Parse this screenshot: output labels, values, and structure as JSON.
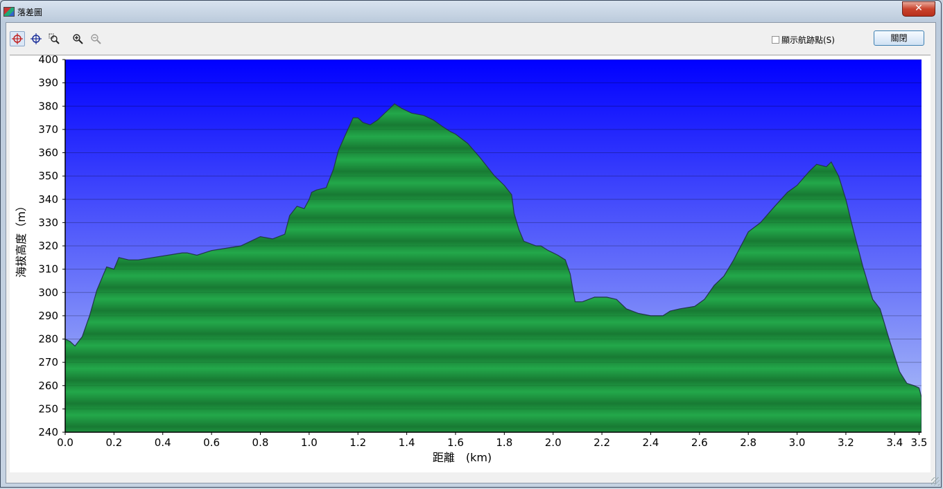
{
  "window": {
    "title": "落差圖",
    "close_glyph": "✕"
  },
  "toolbar": {
    "tools": [
      {
        "name": "crosshair-red-icon",
        "active": true
      },
      {
        "name": "crosshair-blue-icon",
        "active": false
      },
      {
        "name": "zoom-box-icon",
        "active": false
      },
      {
        "name": "zoom-in-icon",
        "active": false
      },
      {
        "name": "zoom-out-icon",
        "active": false
      }
    ],
    "show_waypoints_label": "顯示航跡點(S)",
    "show_waypoints_checked": false,
    "close_label": "關閉"
  },
  "colors": {
    "sky_top": "#0000ff",
    "sky_bottom": "#b3c6f6",
    "terrain_light": "#23a84a",
    "terrain_dark": "#187a33",
    "outline": "#22364a"
  },
  "chart_data": {
    "type": "area",
    "title": "",
    "xlabel": "距離　(km)",
    "ylabel": "海拔高度（m）",
    "xlim": [
      0,
      3.51
    ],
    "ylim": [
      240,
      400
    ],
    "xticks": [
      "0.0",
      "0.2",
      "0.4",
      "0.6",
      "0.8",
      "1.0",
      "1.2",
      "1.4",
      "1.6",
      "1.8",
      "2.0",
      "2.2",
      "2.4",
      "2.6",
      "2.8",
      "3.0",
      "3.2",
      "3.4",
      "3.5"
    ],
    "xtick_values": [
      0,
      0.2,
      0.4,
      0.6,
      0.8,
      1.0,
      1.2,
      1.4,
      1.6,
      1.8,
      2.0,
      2.2,
      2.4,
      2.6,
      2.8,
      3.0,
      3.2,
      3.4,
      3.5
    ],
    "yticks": [
      240,
      250,
      260,
      270,
      280,
      290,
      300,
      310,
      320,
      330,
      340,
      350,
      360,
      370,
      380,
      390,
      400
    ],
    "grid": true,
    "legend": "none",
    "series": [
      {
        "x": [
          0.0,
          0.02,
          0.04,
          0.07,
          0.1,
          0.13,
          0.17,
          0.2,
          0.22,
          0.26,
          0.3,
          0.36,
          0.42,
          0.48,
          0.5,
          0.54,
          0.6,
          0.66,
          0.72,
          0.76,
          0.8,
          0.85,
          0.9,
          0.92,
          0.95,
          0.98,
          1.0,
          1.01,
          1.03,
          1.07,
          1.1,
          1.12,
          1.15,
          1.18,
          1.2,
          1.22,
          1.25,
          1.28,
          1.3,
          1.32,
          1.35,
          1.38,
          1.42,
          1.47,
          1.51,
          1.55,
          1.58,
          1.6,
          1.65,
          1.7,
          1.76,
          1.8,
          1.83,
          1.84,
          1.86,
          1.88,
          1.93,
          1.95,
          1.98,
          2.0,
          2.02,
          2.05,
          2.07,
          2.09,
          2.12,
          2.17,
          2.22,
          2.26,
          2.3,
          2.35,
          2.4,
          2.45,
          2.48,
          2.52,
          2.58,
          2.62,
          2.66,
          2.7,
          2.74,
          2.8,
          2.85,
          2.9,
          2.96,
          3.0,
          3.05,
          3.08,
          3.12,
          3.14,
          3.17,
          3.2,
          3.23,
          3.27,
          3.31,
          3.34,
          3.38,
          3.42,
          3.45,
          3.48,
          3.5,
          3.51
        ],
        "y": [
          280,
          279,
          277,
          281,
          290,
          301,
          311,
          310,
          315,
          314,
          314,
          315,
          316,
          317,
          317,
          316,
          318,
          319,
          320,
          322,
          324,
          323,
          325,
          333,
          337,
          336,
          340,
          343,
          344,
          345,
          353,
          361,
          368,
          375,
          375,
          373,
          372,
          374,
          376,
          378,
          381,
          379,
          377,
          376,
          374,
          371,
          369,
          368,
          364,
          358,
          350,
          346,
          342,
          334,
          327,
          322,
          320,
          320,
          318,
          317,
          316,
          314,
          308,
          296,
          296,
          298,
          298,
          297,
          293,
          291,
          290,
          290,
          292,
          293,
          294,
          297,
          303,
          307,
          314,
          326,
          330,
          336,
          343,
          346,
          352,
          355,
          354,
          356,
          350,
          340,
          327,
          311,
          297,
          293,
          279,
          266,
          261,
          260,
          259,
          255
        ]
      }
    ]
  }
}
